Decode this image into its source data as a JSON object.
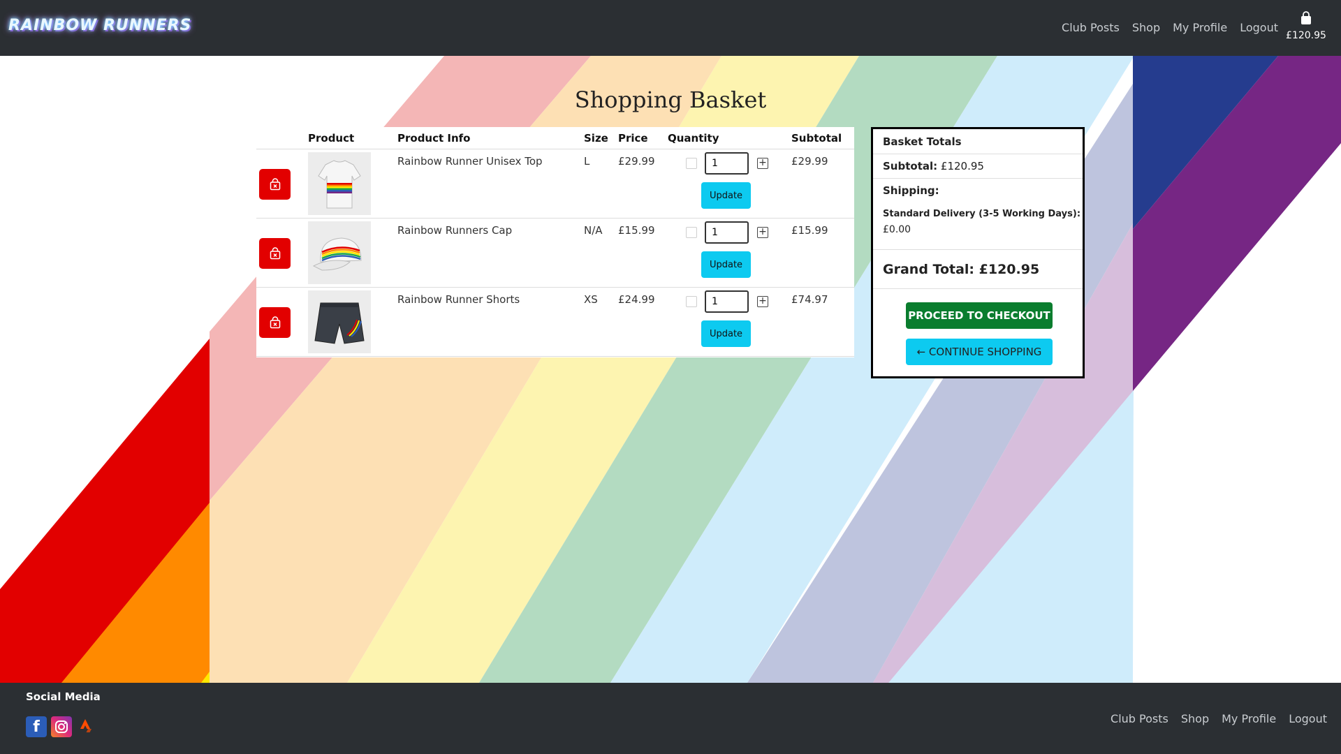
{
  "brand": {
    "logo_text": "RAINBOW RUNNERS"
  },
  "nav": {
    "links": [
      "Club Posts",
      "Shop",
      "My Profile",
      "Logout"
    ],
    "basket_total": "£120.95"
  },
  "page": {
    "title": "Shopping Basket"
  },
  "table": {
    "headers": [
      "Product",
      "Product Info",
      "Size",
      "Price",
      "Quantity",
      "Subtotal"
    ],
    "rows": [
      {
        "name": "Rainbow Runner Unisex Top",
        "size": "L",
        "price": "£29.99",
        "quantity": "1",
        "subtotal": "£29.99",
        "update_label": "Update"
      },
      {
        "name": "Rainbow Runners Cap",
        "size": "N/A",
        "price": "£15.99",
        "quantity": "1",
        "subtotal": "£15.99",
        "update_label": "Update"
      },
      {
        "name": "Rainbow Runner Shorts",
        "size": "XS",
        "price": "£24.99",
        "quantity": "1",
        "subtotal": "£74.97",
        "update_label": "Update"
      }
    ]
  },
  "totals": {
    "heading": "Basket Totals",
    "subtotal_label": "Subtotal:",
    "subtotal_value": "£120.95",
    "shipping_label": "Shipping:",
    "delivery_label": "Standard Delivery (3-5 Working Days):",
    "delivery_value": "£0.00",
    "grand_total": "Grand Total: £120.95",
    "checkout_label": "PROCEED TO CHECKOUT",
    "continue_label": "CONTINUE SHOPPING"
  },
  "footer": {
    "social_title": "Social Media",
    "social_icons": [
      "facebook-icon",
      "instagram-icon",
      "strava-icon"
    ],
    "links": [
      "Club Posts",
      "Shop",
      "My Profile",
      "Logout"
    ]
  },
  "colors": {
    "navbar": "#2b2f33",
    "remove": "#e20000",
    "checkout": "#0a7d2e",
    "info": "#0dcaf0"
  }
}
